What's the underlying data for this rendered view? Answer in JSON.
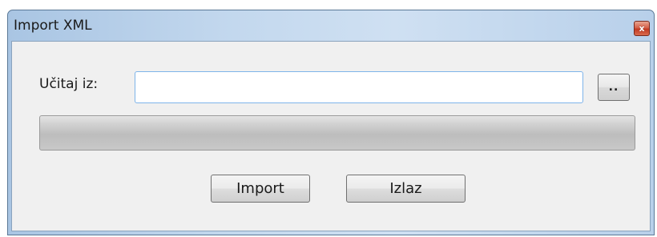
{
  "window": {
    "title": "Import XML",
    "close_icon": "close-icon",
    "close_glyph": "x"
  },
  "form": {
    "load_label": "Učitaj iz:",
    "path_value": "",
    "browse_label": ".."
  },
  "progress": {
    "value_percent": 0
  },
  "buttons": {
    "import_label": "Import",
    "exit_label": "Izlaz"
  },
  "colors": {
    "titlebar": "#c3d8ee",
    "close_button": "#c23a22",
    "input_border": "#7eb4ea"
  }
}
